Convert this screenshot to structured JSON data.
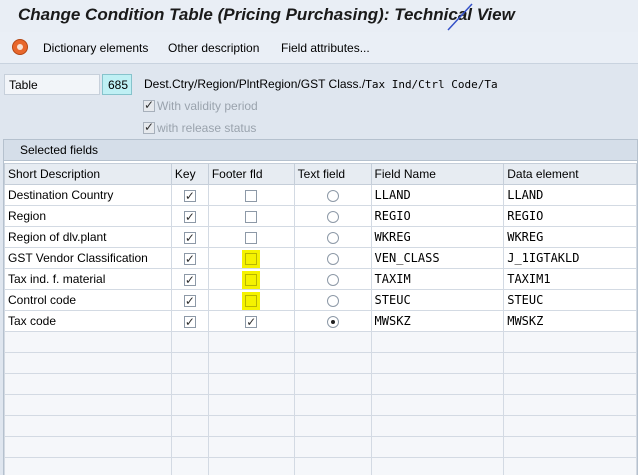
{
  "title": "Change Condition Table (Pricing Purchasing): Technical View",
  "toolbar": {
    "icon": "condition-icon",
    "items": [
      "Dictionary elements",
      "Other description",
      "Field attributes..."
    ]
  },
  "table_field": {
    "label": "Table",
    "value": "685",
    "description": "Dest.Ctry/Region/PlntRegion/GST Class./",
    "description_mono": "Tax Ind/Ctrl Code/Ta"
  },
  "options": {
    "validity_label": "With validity period",
    "validity_checked": true,
    "release_label": "with release status",
    "release_checked": true
  },
  "panel": {
    "title": "Selected fields",
    "columns": [
      "Short Description",
      "Key",
      "Footer fld",
      "Text field",
      "Field Name",
      "Data element"
    ],
    "rows": [
      {
        "desc": "Destination Country",
        "key": true,
        "footer": false,
        "footer_hl": false,
        "text": false,
        "field": "LLAND",
        "element": "LLAND"
      },
      {
        "desc": "Region",
        "key": true,
        "footer": false,
        "footer_hl": false,
        "text": false,
        "field": "REGIO",
        "element": "REGIO"
      },
      {
        "desc": "Region of dlv.plant",
        "key": true,
        "footer": false,
        "footer_hl": false,
        "text": false,
        "field": "WKREG",
        "element": "WKREG"
      },
      {
        "desc": "GST Vendor Classification",
        "key": true,
        "footer": false,
        "footer_hl": true,
        "text": false,
        "field": "VEN_CLASS",
        "element": "J_1IGTAKLD"
      },
      {
        "desc": "Tax ind. f. material",
        "key": true,
        "footer": false,
        "footer_hl": true,
        "text": false,
        "field": "TAXIM",
        "element": "TAXIM1"
      },
      {
        "desc": "Control code",
        "key": true,
        "footer": false,
        "footer_hl": true,
        "text": false,
        "field": "STEUC",
        "element": "STEUC"
      },
      {
        "desc": "Tax code",
        "key": true,
        "footer": true,
        "footer_hl": false,
        "text": true,
        "field": "MWSKZ",
        "element": "MWSKZ"
      }
    ],
    "empty_rows": 7
  },
  "colors": {
    "highlight": "#f5f200",
    "table_value_bg": "#bff0f4"
  }
}
